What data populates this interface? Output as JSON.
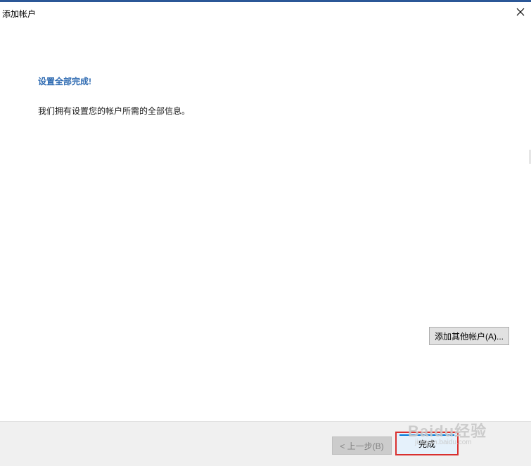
{
  "window": {
    "title": "添加帐户",
    "close_icon": "close-icon"
  },
  "main": {
    "heading": "设置全部完成!",
    "description": "我们拥有设置您的帐户所需的全部信息。",
    "add_other_button": "添加其他帐户(A)..."
  },
  "footer": {
    "back_button": "< 上一步(B)",
    "finish_button": "完成"
  },
  "watermark": {
    "logo": "Baidu经验",
    "sub": "jingyan.baidu.com"
  },
  "colors": {
    "accent": "#2b5797",
    "heading": "#2f6bb2",
    "highlight_border": "#d9302f"
  }
}
